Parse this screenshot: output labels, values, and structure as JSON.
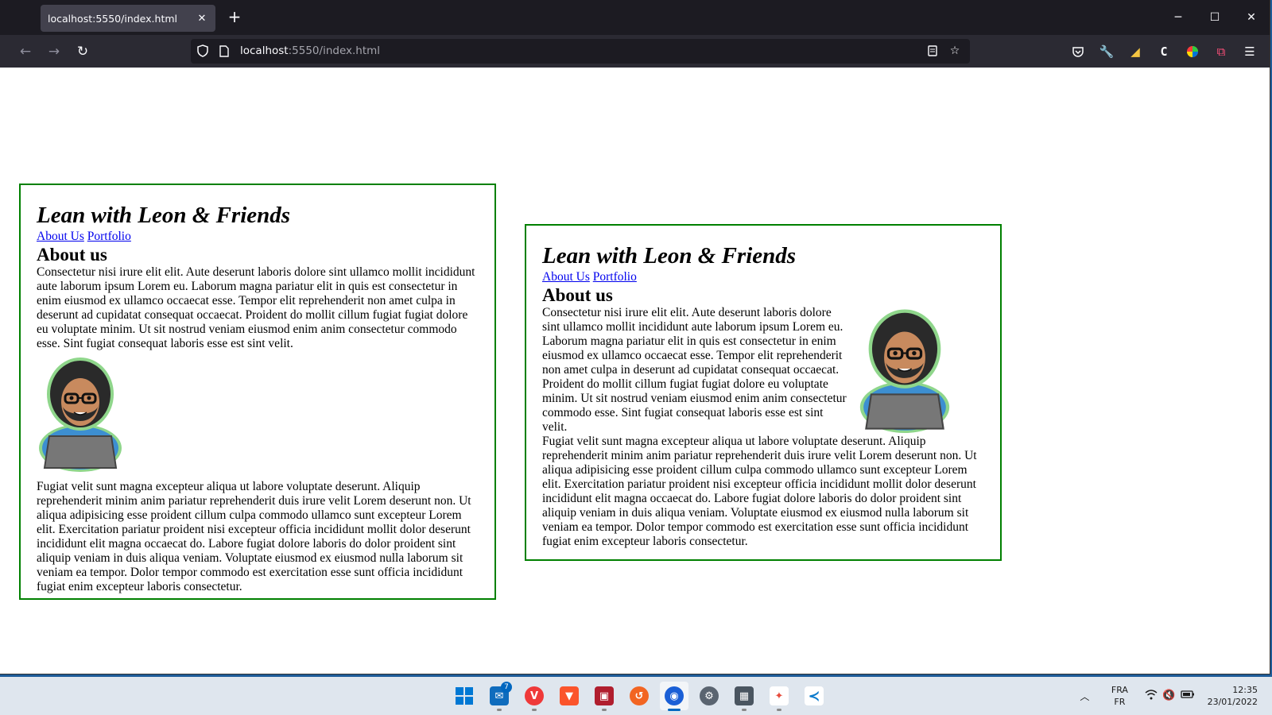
{
  "browser": {
    "tab_title": "localhost:5550/index.html",
    "url_host": "localhost",
    "url_path": ":5550/index.html"
  },
  "page": {
    "left_card": {
      "title": "Lean with Leon & Friends",
      "links": [
        "About Us",
        "Portfolio"
      ],
      "heading": "About us",
      "paragraph1": "Consectetur nisi irure elit elit. Aute deserunt laboris dolore sint ullamco mollit incididunt aute laborum ipsum Lorem eu. Laborum magna pariatur elit in quis est consectetur in enim eiusmod ex ullamco occaecat esse. Tempor elit reprehenderit non amet culpa in deserunt ad cupidatat consequat occaecat. Proident do mollit cillum fugiat fugiat dolore eu voluptate minim. Ut sit nostrud veniam eiusmod enim anim consectetur commodo esse. Sint fugiat consequat laboris esse est sint velit.",
      "paragraph2": "Fugiat velit sunt magna excepteur aliqua ut labore voluptate deserunt. Aliquip reprehenderit minim anim pariatur reprehenderit duis irure velit Lorem deserunt non. Ut aliqua adipisicing esse proident cillum culpa commodo ullamco sunt excepteur Lorem elit. Exercitation pariatur proident nisi excepteur officia incididunt mollit dolor deserunt incididunt elit magna occaecat do. Labore fugiat dolore laboris do dolor proident sint aliquip veniam in duis aliqua veniam. Voluptate eiusmod ex eiusmod nulla laborum sit veniam ea tempor. Dolor tempor commodo est exercitation esse sunt officia incididunt fugiat enim excepteur laboris consectetur."
    },
    "right_card": {
      "title": "Lean with Leon & Friends",
      "links": [
        "About Us",
        "Portfolio"
      ],
      "heading": "About us",
      "paragraph1": "Consectetur nisi irure elit elit. Aute deserunt laboris dolore sint ullamco mollit incididunt aute laborum ipsum Lorem eu. Laborum magna pariatur elit in quis est consectetur in enim eiusmod ex ullamco occaecat esse. Tempor elit reprehenderit non amet culpa in deserunt ad cupidatat consequat occaecat. Proident do mollit cillum fugiat fugiat dolore eu voluptate minim. Ut sit nostrud veniam eiusmod enim anim consectetur commodo esse. Sint fugiat consequat laboris esse est sint velit.",
      "paragraph2": "Fugiat velit sunt magna excepteur aliqua ut labore voluptate deserunt. Aliquip reprehenderit minim anim pariatur reprehenderit duis irure velit Lorem deserunt non. Ut aliqua adipisicing esse proident cillum culpa commodo ullamco sunt excepteur Lorem elit. Exercitation pariatur proident nisi excepteur officia incididunt mollit dolor deserunt incididunt elit magna occaecat do. Labore fugiat dolore laboris do dolor proident sint aliquip veniam in duis aliqua veniam. Voluptate eiusmod ex eiusmod nulla laborum sit veniam ea tempor. Dolor tempor commodo est exercitation esse sunt officia incididunt fugiat enim excepteur laboris consectetur."
    }
  },
  "taskbar": {
    "mail_badge": "7",
    "lang_top": "FRA",
    "lang_bottom": "FR",
    "time": "12:35",
    "date": "23/01/2022"
  },
  "colors": {
    "card_border": "#008000",
    "link": "#0000ee",
    "browser_chrome": "#1c1b22",
    "toolbar": "#2b2a33"
  },
  "icons": [
    "back-arrow-icon",
    "forward-arrow-icon",
    "reload-icon",
    "shield-icon",
    "page-icon",
    "reader-view-icon",
    "bookmark-star-icon",
    "pocket-icon",
    "wrench-icon",
    "extension-icon",
    "menu-icon"
  ]
}
